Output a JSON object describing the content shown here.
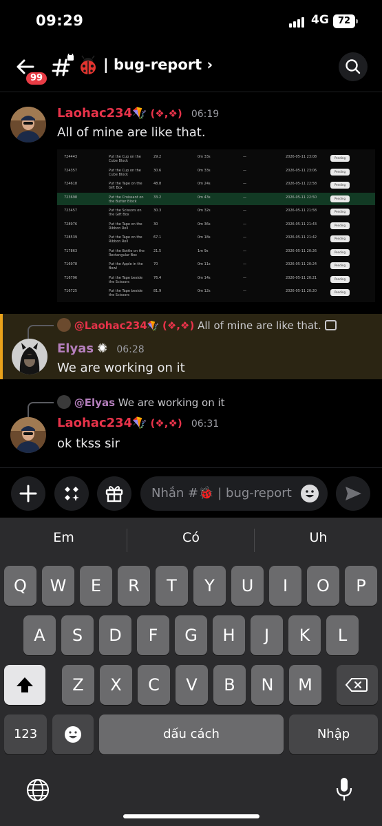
{
  "status": {
    "time": "09:29",
    "network": "4G",
    "battery": "72"
  },
  "header": {
    "unread_badge": "99",
    "channel_name": "| bug-report ›"
  },
  "messages": [
    {
      "username": "Laohac234",
      "tag": "(❖,❖)",
      "time": "06:19",
      "text": "All of mine are like that."
    },
    {
      "reply_to_user": "@Laohac234",
      "reply_to_tag": "(❖,❖)",
      "reply_to_text": "All of mine are like that.",
      "username": "Elyas",
      "time": "06:28",
      "text": "We are working on it"
    },
    {
      "reply_to_user": "@Elyas",
      "reply_to_text": "We are working on it",
      "username": "Laohac234",
      "tag": "(❖,❖)",
      "time": "06:31",
      "text": "ok tkss sir"
    }
  ],
  "attachment_rows": [
    {
      "id": "724443",
      "task": "Put the Cup on the Cube Block",
      "score": "29.2",
      "dur": "0m 33s",
      "dash": "—",
      "date": "2026-05-11 23:08",
      "status": "Pending"
    },
    {
      "id": "724357",
      "task": "Put the Cup on the Cube Block",
      "score": "30.6",
      "dur": "0m 33s",
      "dash": "—",
      "date": "2026-05-11 23:06",
      "status": "Pending"
    },
    {
      "id": "724618",
      "task": "Put the Tape on the Gift Box",
      "score": "48.8",
      "dur": "0m 24s",
      "dash": "—",
      "date": "2026-05-11 22:58",
      "status": "Pending"
    },
    {
      "id": "723698",
      "task": "Put the Croissant on the Butter Block",
      "score": "33.2",
      "dur": "0m 43s",
      "dash": "—",
      "date": "2026-05-11 22:50",
      "status": "Pending"
    },
    {
      "id": "723457",
      "task": "Put the Scissors on the Gift Box",
      "score": "30.3",
      "dur": "0m 32s",
      "dash": "—",
      "date": "2026-05-11 21:58",
      "status": "Pending"
    },
    {
      "id": "728976",
      "task": "Put the Tape on the Ribbon Roll",
      "score": "30",
      "dur": "0m 36s",
      "dash": "—",
      "date": "2026-05-11 21:43",
      "status": "Pending"
    },
    {
      "id": "728539",
      "task": "Put the Tape on the Ribbon Roll",
      "score": "67.1",
      "dur": "0m 18s",
      "dash": "—",
      "date": "2026-05-11 21:42",
      "status": "Pending"
    },
    {
      "id": "717863",
      "task": "Put the Bottle on the Rectangular Box",
      "score": "21.5",
      "dur": "1m 9s",
      "dash": "—",
      "date": "2026-05-11 20:26",
      "status": "Pending"
    },
    {
      "id": "716978",
      "task": "Put the Apple in the Bowl",
      "score": "70",
      "dur": "0m 11s",
      "dash": "—",
      "date": "2026-05-11 20:24",
      "status": "Pending"
    },
    {
      "id": "716796",
      "task": "Put the Tape beside the Scissors",
      "score": "76.4",
      "dur": "0m 14s",
      "dash": "—",
      "date": "2026-05-11 20:21",
      "status": "Pending"
    },
    {
      "id": "716725",
      "task": "Put the Tape beside the Scissors",
      "score": "81.9",
      "dur": "0m 12s",
      "dash": "—",
      "date": "2026-05-11 20:20",
      "status": "Pending"
    }
  ],
  "composer": {
    "placeholder": "Nhắn #🐞 | bug-report"
  },
  "keyboard": {
    "suggestions": [
      "Em",
      "Có",
      "Uh"
    ],
    "row1": [
      "Q",
      "W",
      "E",
      "R",
      "T",
      "Y",
      "U",
      "I",
      "O",
      "P"
    ],
    "row2": [
      "A",
      "S",
      "D",
      "F",
      "G",
      "H",
      "J",
      "K",
      "L"
    ],
    "row3": [
      "Z",
      "X",
      "C",
      "V",
      "B",
      "N",
      "M"
    ],
    "numbers_key": "123",
    "space_key": "dấu cách",
    "return_key": "Nhập"
  },
  "colors": {
    "background": "#000000",
    "mention_red": "#e8334a",
    "highlight_bar": "#e9a21b",
    "elyas_purple": "#b57fbd"
  }
}
